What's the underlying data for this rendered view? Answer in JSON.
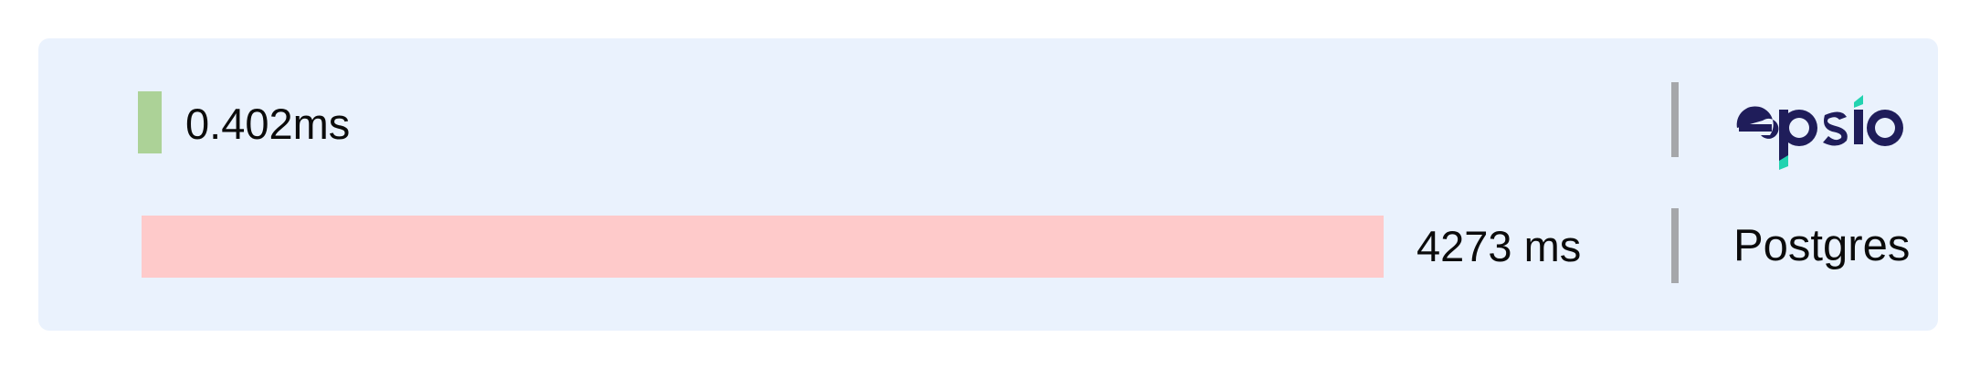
{
  "chart_data": {
    "type": "bar",
    "orientation": "horizontal",
    "categories": [
      "epsio",
      "Postgres"
    ],
    "values": [
      0.402,
      4273
    ],
    "value_labels": [
      "0.402ms",
      "4273 ms"
    ],
    "unit": "ms",
    "colors": {
      "epsio": "#acd297",
      "Postgres": "#fecaca",
      "logo_dark": "#1f1d5a",
      "logo_accent": "#22d3b0"
    },
    "grid": false,
    "legend": "none"
  }
}
